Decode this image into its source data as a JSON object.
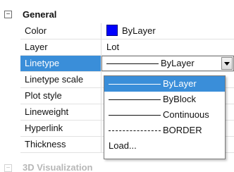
{
  "section": {
    "toggle": "−",
    "title": "General"
  },
  "properties": [
    {
      "label": "Color",
      "value": "ByLayer"
    },
    {
      "label": "Layer",
      "value": "Lot"
    },
    {
      "label": "Linetype",
      "value": "ByLayer"
    },
    {
      "label": "Linetype scale",
      "value": ""
    },
    {
      "label": "Plot style",
      "value": ""
    },
    {
      "label": "Lineweight",
      "value": ""
    },
    {
      "label": "Hyperlink",
      "value": ""
    },
    {
      "label": "Thickness",
      "value": ""
    }
  ],
  "linetype_dropdown": {
    "options": [
      "ByLayer",
      "ByBlock",
      "Continuous",
      "BORDER"
    ],
    "selected": "ByLayer",
    "load_label": "Load..."
  },
  "next_section": {
    "toggle": "−",
    "title": "3D Visualization"
  },
  "colors": {
    "selection": "#3a8ed9",
    "color_swatch": "#0000ff"
  }
}
